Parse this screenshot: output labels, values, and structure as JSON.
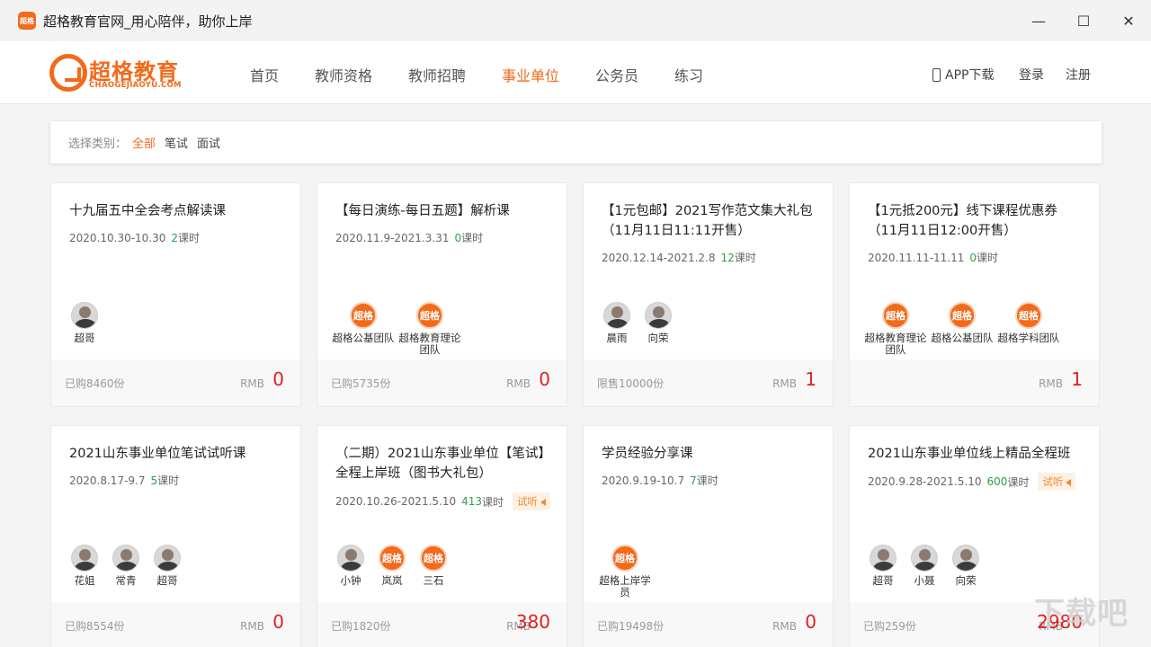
{
  "window": {
    "title": "超格教育官网_用心陪伴，助你上岸",
    "app_icon": "超格",
    "min": "—",
    "max": "☐",
    "close": "✕"
  },
  "logo": {
    "cn": "超格教育",
    "en": "CHAOGEJIAOYU.COM"
  },
  "nav": [
    "首页",
    "教师资格",
    "教师招聘",
    "事业单位",
    "公务员",
    "练习"
  ],
  "header_right": {
    "app": "APP下载",
    "login": "登录",
    "register": "注册"
  },
  "filter": {
    "label": "选择类别：",
    "options": [
      "全部",
      "笔试",
      "面试"
    ]
  },
  "cards": [
    {
      "title": "十九届五中全会考点解读课",
      "date": "2020.10.30-10.30",
      "lessons": "2",
      "lesson_unit": "课时",
      "teachers": [
        "超哥"
      ],
      "sold": "已购8460份",
      "rmb": "RMB",
      "price": "0"
    },
    {
      "title": "【每日演练-每日五题】解析课",
      "date": "2020.11.9-2021.3.31",
      "lessons": "0",
      "lesson_unit": "课时",
      "teachers": [
        "超格公基团队",
        "超格教育理论团队"
      ],
      "sold": "已购5735份",
      "rmb": "RMB",
      "price": "0"
    },
    {
      "title": "【1元包邮】2021写作范文集大礼包（11月11日11:11开售）",
      "date": "2020.12.14-2021.2.8",
      "lessons": "12",
      "lesson_unit": "课时",
      "teachers": [
        "晨雨",
        "向荣"
      ],
      "sold": "限售10000份",
      "rmb": "RMB",
      "price": "1"
    },
    {
      "title": "【1元抵200元】线下课程优惠券（11月11日12:00开售）",
      "date": "2020.11.11-11.11",
      "lessons": "0",
      "lesson_unit": "课时",
      "teachers": [
        "超格教育理论团队",
        "超格公基团队",
        "超格学科团队"
      ],
      "sold": "",
      "rmb": "RMB",
      "price": "1"
    },
    {
      "title": "2021山东事业单位笔试试听课",
      "date": "2020.8.17-9.7",
      "lessons": "5",
      "lesson_unit": "课时",
      "teachers": [
        "花姐",
        "常青",
        "超哥"
      ],
      "sold": "已购8554份",
      "rmb": "RMB",
      "price": "0"
    },
    {
      "title": "（二期）2021山东事业单位【笔试】全程上岸班（图书大礼包）",
      "date": "2020.10.26-2021.5.10",
      "lessons": "413",
      "lesson_unit": "课时",
      "badge": "试听",
      "teachers": [
        "小钟",
        "岚岚",
        "三石"
      ],
      "sold": "已购1820份",
      "rmb": "RMB",
      "price": "380"
    },
    {
      "title": "学员经验分享课",
      "date": "2020.9.19-10.7",
      "lessons": "7",
      "lesson_unit": "课时",
      "teachers": [
        "超格上岸学员"
      ],
      "sold": "已购19498份",
      "rmb": "RMB",
      "price": "0"
    },
    {
      "title": "2021山东事业单位线上精品全程班",
      "date": "2020.9.28-2021.5.10",
      "lessons": "600",
      "lesson_unit": "课时",
      "badge": "试听",
      "teachers": [
        "超哥",
        "小聂",
        "向荣"
      ],
      "sold": "已购259份",
      "rmb": "RMB",
      "price": "2980"
    }
  ],
  "brand_avatar_text": "超格",
  "watermark": "下载吧",
  "colors": {
    "accent": "#f26a1b",
    "price": "#e02020",
    "lessons": "#2aa14a"
  }
}
